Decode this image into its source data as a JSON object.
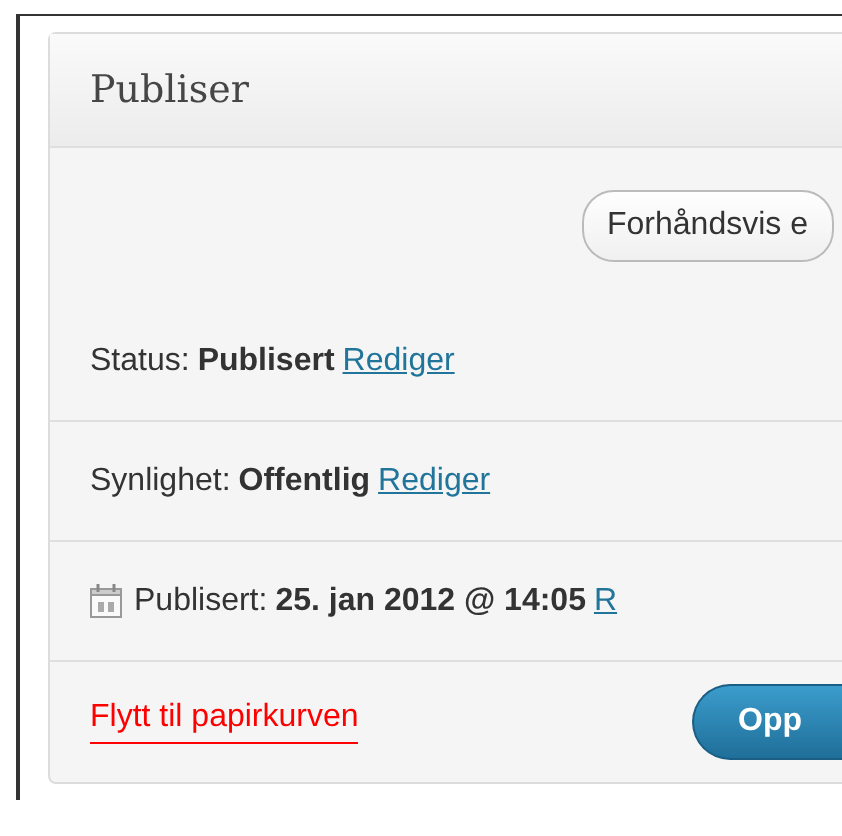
{
  "panel": {
    "title": "Publiser",
    "preview_button": "Forhåndsvis e",
    "fields": [
      {
        "kind": "status",
        "label": "Status:",
        "value": "Publisert",
        "link": "Rediger"
      },
      {
        "kind": "visibility",
        "label": "Synlighet:",
        "value": "Offentlig",
        "link": "Rediger"
      },
      {
        "kind": "date",
        "label": "Publisert:",
        "value": "25. jan 2012 @ 14:05",
        "link": "R"
      }
    ],
    "trash_link": "Flytt til papirkurven",
    "publish_button": "Opp"
  }
}
